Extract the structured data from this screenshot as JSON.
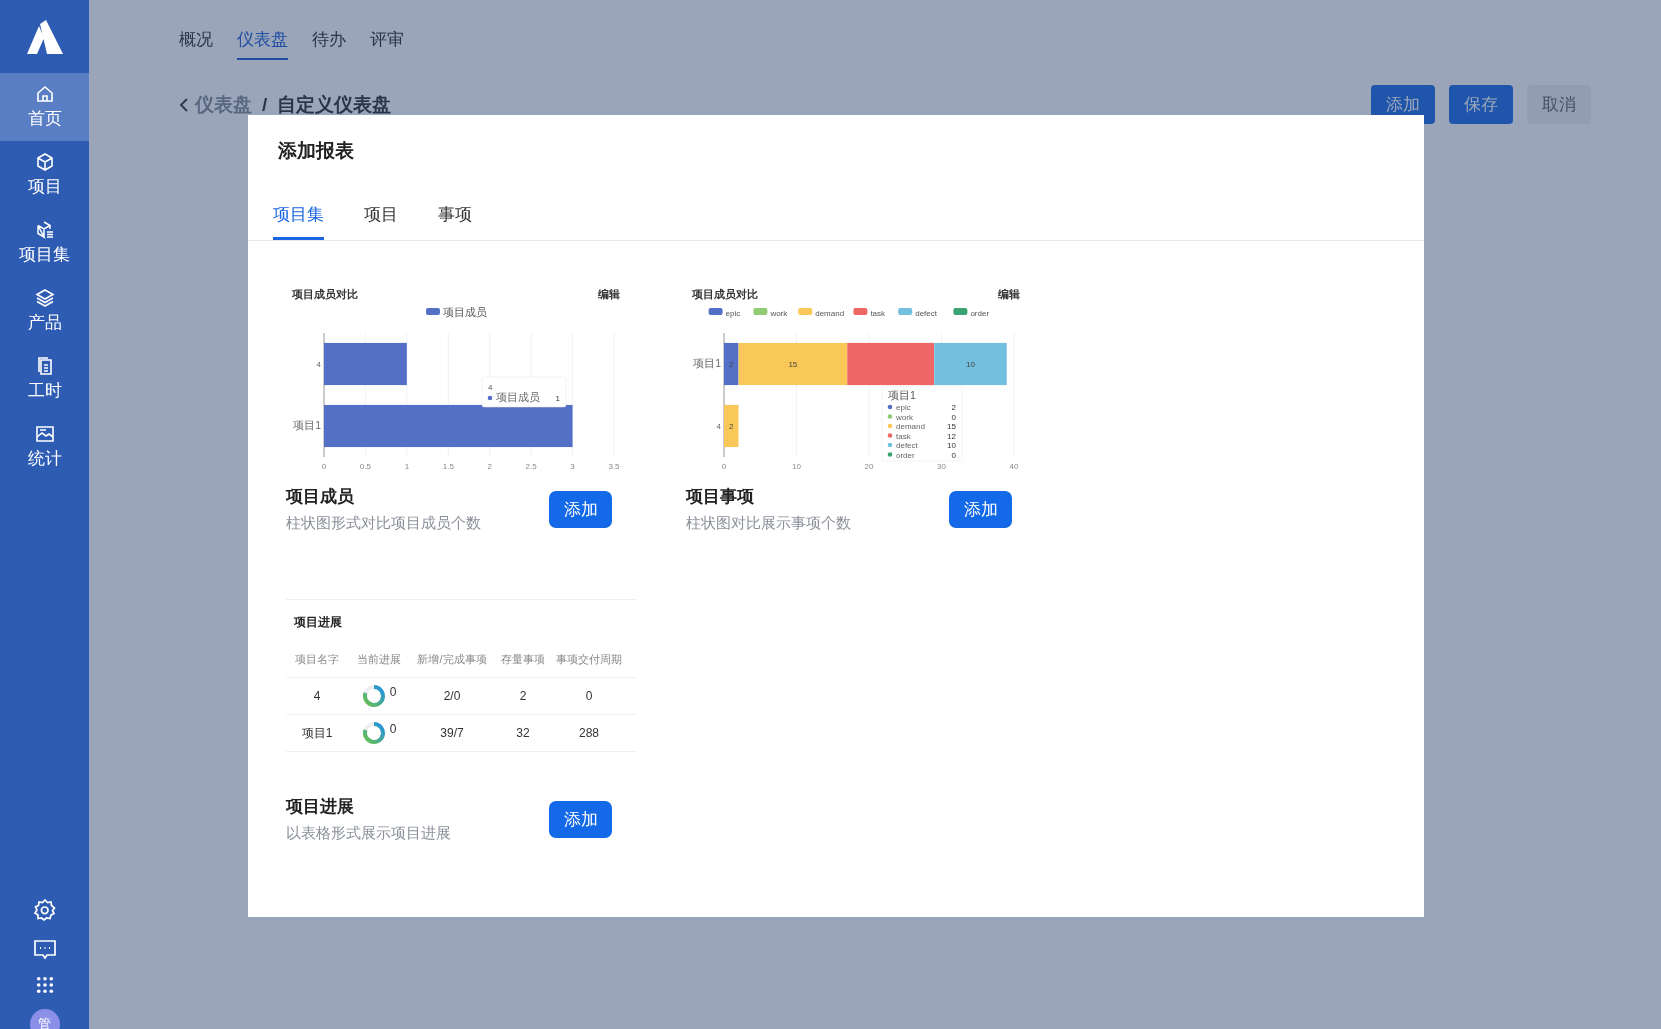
{
  "sidebar": {
    "items": [
      {
        "label": "首页",
        "selected": true
      },
      {
        "label": "项目",
        "selected": false
      },
      {
        "label": "项目集",
        "selected": false
      },
      {
        "label": "产品",
        "selected": false
      },
      {
        "label": "工时",
        "selected": false
      },
      {
        "label": "统计",
        "selected": false
      }
    ],
    "avatar": "管"
  },
  "top_tabs": [
    {
      "label": "概况",
      "selected": false
    },
    {
      "label": "仪表盘",
      "selected": true
    },
    {
      "label": "待办",
      "selected": false
    },
    {
      "label": "评审",
      "selected": false
    }
  ],
  "breadcrumb": {
    "back": "仪表盘",
    "separator": "/",
    "current": "自定义仪表盘"
  },
  "header_buttons": [
    {
      "label": "添加",
      "kind": "primary"
    },
    {
      "label": "保存",
      "kind": "primary"
    },
    {
      "label": "取消",
      "kind": "secondary"
    }
  ],
  "dialog": {
    "title": "添加报表",
    "tabs": [
      {
        "label": "项目集",
        "selected": true
      },
      {
        "label": "项目",
        "selected": false
      },
      {
        "label": "事项",
        "selected": false
      }
    ],
    "cards": [
      {
        "kind": "chart",
        "name": "项目成员",
        "description": "柱状图形式对比项目成员个数",
        "button": "添加",
        "edit_link": "编辑",
        "chart_data": {
          "type": "bar",
          "orientation": "horizontal",
          "title": "项目成员对比",
          "grid": true,
          "legend": true,
          "categories": [
            "4",
            "项目1"
          ],
          "xlim": [
            0,
            3.5
          ],
          "xticks": [
            0,
            0.5,
            1,
            1.5,
            2,
            2.5,
            3,
            3.5
          ],
          "series": [
            {
              "name": "项目成员",
              "color": "#5470c6",
              "values": [
                1,
                3
              ]
            }
          ]
        },
        "tooltip": {
          "title": "4",
          "items": [
            {
              "name": "项目成员",
              "value": "1"
            }
          ]
        }
      },
      {
        "kind": "chart",
        "name": "项目事项",
        "description": "柱状图对比展示事项个数",
        "button": "添加",
        "edit_link": "编辑",
        "chart_data": {
          "type": "bar",
          "orientation": "horizontal",
          "stacked": true,
          "title": "项目成员对比",
          "grid": true,
          "legend": true,
          "categories": [
            "项目1",
            "4"
          ],
          "xlim": [
            0,
            40
          ],
          "xticks": [
            0,
            10,
            20,
            30,
            40
          ],
          "series": [
            {
              "name": "epic",
              "color": "#5470c6",
              "values": [
                2,
                0
              ]
            },
            {
              "name": "work",
              "color": "#91cc75",
              "values": [
                0,
                0
              ]
            },
            {
              "name": "demand",
              "color": "#fac858",
              "values": [
                15,
                2
              ]
            },
            {
              "name": "task",
              "color": "#ee6666",
              "values": [
                12,
                0
              ]
            },
            {
              "name": "defect",
              "color": "#73c0de",
              "values": [
                10,
                0
              ]
            },
            {
              "name": "order",
              "color": "#3ba272",
              "values": [
                0,
                0
              ]
            }
          ],
          "value_labels": [
            [
              "2",
              null
            ],
            [
              null,
              null
            ],
            [
              "15",
              "2"
            ],
            [
              null,
              null
            ],
            [
              "10",
              null
            ],
            [
              null,
              null
            ]
          ]
        },
        "tooltip": {
          "title": "项目1",
          "items": [
            {
              "name": "epic",
              "value": "2"
            },
            {
              "name": "work",
              "value": "0"
            },
            {
              "name": "demand",
              "value": "15"
            },
            {
              "name": "task",
              "value": "12"
            },
            {
              "name": "defect",
              "value": "10"
            },
            {
              "name": "order",
              "value": "0"
            }
          ]
        }
      },
      {
        "kind": "table",
        "name": "项目进展",
        "description": "以表格形式展示项目进展",
        "button": "添加",
        "table": {
          "title": "项目进展",
          "columns": [
            "项目名字",
            "当前进展",
            "新增/完成事项",
            "存量事项",
            "事项交付周期"
          ],
          "rows": [
            {
              "name": "4",
              "progress": "0",
              "items": "2/0",
              "stock": "2",
              "cycle": "0"
            },
            {
              "name": "项目1",
              "progress": "0",
              "items": "39/7",
              "stock": "32",
              "cycle": "288"
            }
          ]
        }
      }
    ]
  }
}
